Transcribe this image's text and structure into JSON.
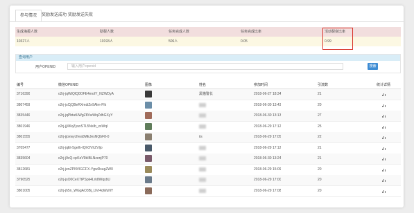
{
  "tabs": [
    {
      "label": "参与情况"
    },
    {
      "label": "奖励发送成功"
    },
    {
      "label": "奖励发送失败"
    }
  ],
  "stats": {
    "headers": [
      "生成海报人数",
      "助裂人数",
      "任务完成人数",
      "任务完成比率",
      "活动裂变比率"
    ],
    "values": [
      "10327人",
      "10193人",
      "506人",
      "0.05",
      "0.99"
    ]
  },
  "search": {
    "title": "查询用户",
    "label": "用户OPENID",
    "placeholder": "输入用户openid",
    "button": "搜索"
  },
  "table": {
    "headers": [
      "编号",
      "微信OPENID",
      "图像",
      "姓名",
      "参加时间",
      "引流数",
      "统计详情"
    ],
    "rows": [
      {
        "id": "3716390",
        "openid": "o2rj-jqWtQlQ0OFE4moIY_NZWDyA",
        "name": "黑猫警长",
        "time": "2018-06-27 18:34",
        "count": "21",
        "avatar": "#3a3a3a"
      },
      {
        "id": "3807459",
        "openid": "o2rj-jsCjQBeRXmdiZn9Alm-FIk",
        "name": "",
        "time": "2018-06-30 13:43",
        "count": "20",
        "avatar": "#6b8ea8"
      },
      {
        "id": "3835446",
        "openid": "o2rj-jqPbtutUWgZ8VwWqZdhGXyY",
        "name": "",
        "time": "2018-06-30 13:13",
        "count": "27",
        "avatar": "#a06b5a"
      },
      {
        "id": "3801946",
        "openid": "o2rj-jjXKqZyuxSTL5NsIb_xsWqI",
        "name": "",
        "time": "2018-06-29 17:12",
        "count": "25",
        "avatar": "#5f7c5a"
      },
      {
        "id": "3801555",
        "openid": "o2rj-jjoxwycfrea0MEJesNQbF8-0",
        "name": "iis",
        "time": "2018-06-29 17:05",
        "count": "22",
        "avatar": "#8a7f70"
      },
      {
        "id": "3705477",
        "openid": "o2rj-jqEt-5geIh-lQhOVhZVljo",
        "name": "",
        "time": "2018-06-29 17:12",
        "count": "21",
        "avatar": "#4a5a6a"
      },
      {
        "id": "3835604",
        "openid": "o2rj-j9cQ-qcKeV9bIBLNzenjP70",
        "name": "",
        "time": "2018-06-30 13:24",
        "count": "21",
        "avatar": "#7a5a6a"
      },
      {
        "id": "3812681",
        "openid": "o2rj-jenZPNVIGCFX-YgwRsugZW0",
        "name": "",
        "time": "2018-06-29 15:09",
        "count": "20",
        "avatar": "#9a8a5a"
      },
      {
        "id": "3790525",
        "openid": "o2rj-jsO0CeX7tPSpk4Lrk8WqybU",
        "name": "",
        "time": "2018-06-29 17:00",
        "count": "20",
        "avatar": "#6a7a8a"
      },
      {
        "id": "3801005",
        "openid": "o2rj-jh5n_WGgAO3Bj_UVr4qWuNY",
        "name": "",
        "time": "2018-06-29 17:08",
        "count": "20",
        "avatar": "#8a6a5a"
      }
    ]
  },
  "colors": {
    "highlight_border": "#d9342b",
    "stats_header_bg": "#f2dede",
    "stats_value_bg": "#fcf8e3",
    "search_header_bg": "#d9edf7",
    "button_bg": "#3f8dd4"
  }
}
